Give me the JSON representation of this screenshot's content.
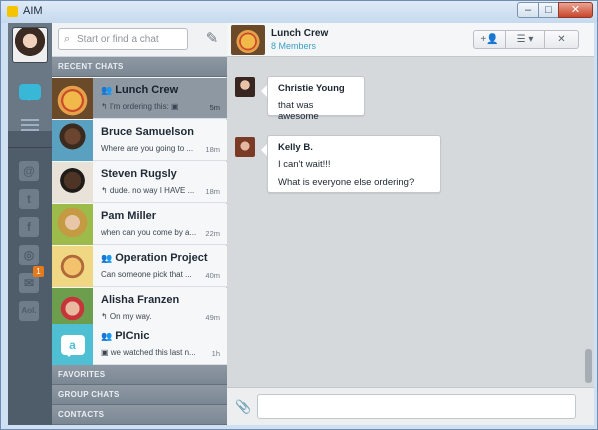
{
  "window": {
    "title": "AIM",
    "controls": [
      "–",
      "□",
      "✕"
    ]
  },
  "rail": {
    "notification_count": "1",
    "icons": [
      "chat-icon",
      "list-icon",
      "at-icon",
      "twitter-icon",
      "facebook-icon",
      "instagram-icon",
      "mail-icon",
      "aol-icon"
    ],
    "glyphs": {
      "at": "@",
      "tw": "t",
      "fb": "f",
      "ig": "◎",
      "mail": "✉",
      "aol": "Aol."
    }
  },
  "search": {
    "placeholder": "Start or find a chat",
    "compose_glyph": "✎",
    "mag": "⌕"
  },
  "sections": {
    "recent": "RECENT CHATS",
    "favorites": "FAVORITES",
    "group_chats": "GROUP CHATS",
    "contacts": "CONTACTS"
  },
  "chats": [
    {
      "name": "Lunch Crew",
      "group": true,
      "preview": "↰ I'm ordering this: ▣",
      "time": "5m",
      "active": true
    },
    {
      "name": "Bruce Samuelson",
      "group": false,
      "preview": "Where are you going to ...",
      "time": "18m",
      "active": false
    },
    {
      "name": "Steven Rugsly",
      "group": false,
      "preview": "↰ dude. no way I HAVE ...",
      "time": "18m",
      "active": false
    },
    {
      "name": "Pam Miller",
      "group": false,
      "preview": "when can you come by a...",
      "time": "22m",
      "active": false
    },
    {
      "name": "Operation Project",
      "group": true,
      "preview": "Can someone pick that ...",
      "time": "40m",
      "active": false
    },
    {
      "name": "Alisha Franzen",
      "group": false,
      "preview": "↰ On my way.",
      "time": "49m",
      "active": false
    },
    {
      "name": "PICnic",
      "group": true,
      "preview": "▣ we watched this last n...",
      "time": "1h",
      "active": false
    }
  ],
  "group_glyph": "👥",
  "conversation": {
    "title": "Lunch Crew",
    "subtitle": "8 Members",
    "buttons": {
      "add": "+👤",
      "menu": "☰ ▾",
      "close": "✕"
    },
    "messages": [
      {
        "sender": "Christie Young",
        "lines": [
          "that was awesome"
        ]
      },
      {
        "sender": "Kelly B.",
        "lines": [
          "I can't wait!!!",
          "What is everyone else ordering?"
        ]
      }
    ],
    "composer": {
      "clip": "📎",
      "value": ""
    }
  }
}
